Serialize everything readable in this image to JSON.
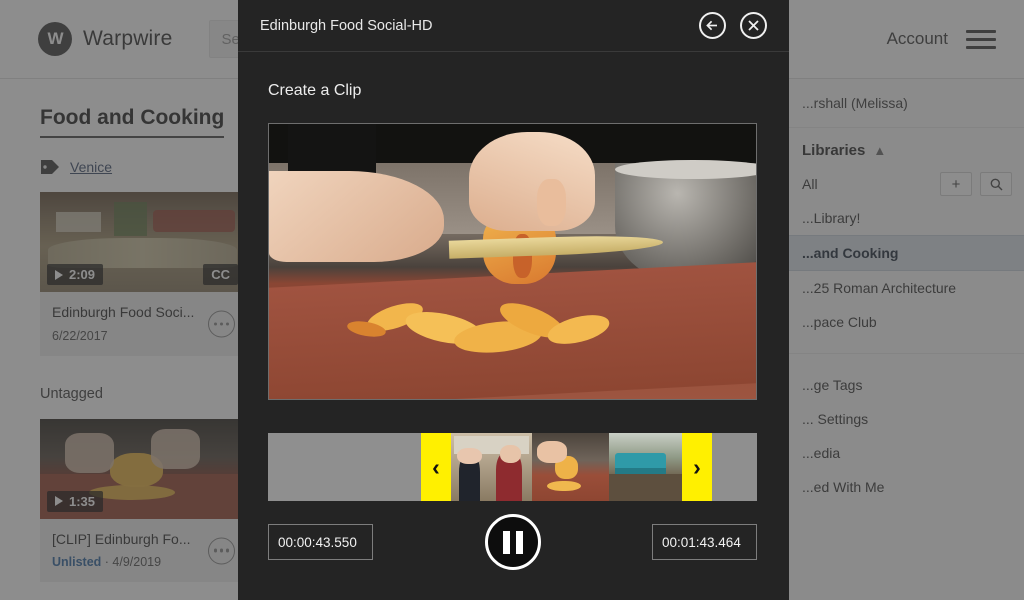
{
  "app": {
    "brand_mark": "W",
    "brand_name": "Warpwire",
    "search": {
      "placeholder": "Search...",
      "value": ""
    },
    "account_label": "Account",
    "menu_icon": "hamburger-icon"
  },
  "main": {
    "page_title": "Food and Cooking",
    "tag_icon": "tag-icon",
    "tag_name": "Venice",
    "untagged_label": "Untagged",
    "cards": [
      {
        "duration": "2:09",
        "cc_badge": "CC",
        "title": "Edinburgh Food Soci...",
        "meta_status": "",
        "meta_date": "6/22/2017"
      },
      {
        "duration": "1:35",
        "cc_badge": "",
        "title": "[CLIP] Edinburgh Fo...",
        "meta_status": "Unlisted",
        "meta_sep": " · ",
        "meta_date": "4/9/2019"
      }
    ]
  },
  "sidebar": {
    "user": "...rshall (Melissa)",
    "group_label": "Libraries",
    "collapse_icon": "chevron-up-icon",
    "all_label": "All",
    "add_label": "+",
    "search_icon": "search-icon",
    "items": [
      {
        "label": "...Library!",
        "active": false
      },
      {
        "label": "...and Cooking",
        "active": true
      },
      {
        "label": "...25 Roman Architecture",
        "active": false
      },
      {
        "label": "...pace Club",
        "active": false
      }
    ],
    "lower_items": [
      {
        "label": "...ge Tags"
      },
      {
        "label": "... Settings"
      },
      {
        "label": "...edia"
      },
      {
        "label": "...ed With Me"
      }
    ]
  },
  "modal": {
    "title": "Edinburgh Food Social-HD",
    "back_icon": "back-arrow-icon",
    "close_icon": "close-icon",
    "heading": "Create a Clip",
    "player": {
      "play_state": "playing",
      "pause_icon": "pause-icon"
    },
    "timeline": {
      "left_handle_icon": "chevron-left-handle",
      "right_handle_icon": "chevron-right-handle",
      "left_chevron": "‹",
      "right_chevron": "›"
    },
    "start_time": "00:00:43.550",
    "end_time": "00:01:43.464"
  },
  "colors": {
    "accent_yellow": "#fff000",
    "modal_bg": "#242424",
    "sidebar_active": "#dde3ea",
    "link_blue": "#3d6fa5"
  }
}
